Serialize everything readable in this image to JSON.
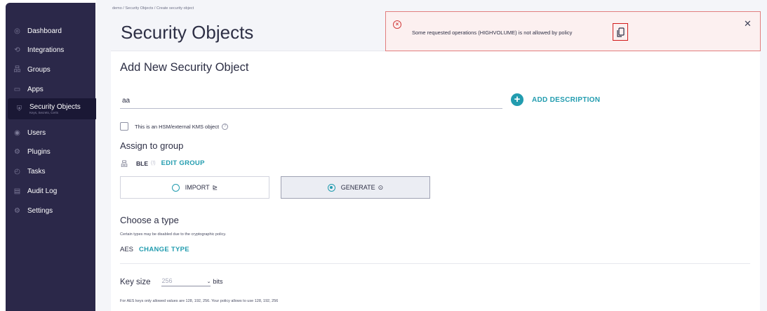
{
  "sidebar": {
    "items": [
      {
        "label": "Dashboard",
        "icon": "dashboard-icon",
        "glyph": "◎"
      },
      {
        "label": "Integrations",
        "icon": "integrations-icon",
        "glyph": "⟲"
      },
      {
        "label": "Groups",
        "icon": "groups-icon",
        "glyph": "品"
      },
      {
        "label": "Apps",
        "icon": "apps-icon",
        "glyph": "▭"
      },
      {
        "label": "Security Objects",
        "sublabel": "Keys, Secrets, Certs",
        "icon": "key-icon",
        "glyph": "⛨",
        "active": true
      },
      {
        "label": "Users",
        "icon": "users-icon",
        "glyph": "◉"
      },
      {
        "label": "Plugins",
        "icon": "plugins-icon",
        "glyph": "⚙"
      },
      {
        "label": "Tasks",
        "icon": "tasks-icon",
        "glyph": "◴"
      },
      {
        "label": "Audit Log",
        "icon": "audit-log-icon",
        "glyph": "▤"
      },
      {
        "label": "Settings",
        "icon": "settings-icon",
        "glyph": "⚙"
      }
    ]
  },
  "breadcrumb": "demo / Security Objects / Create security object",
  "page_title": "Security Objects",
  "form": {
    "title": "Add New Security Object",
    "name_value": "aa",
    "add_description_label": "ADD DESCRIPTION",
    "hsm_label": "This is an HSM/external KMS object",
    "assign_title": "Assign to group",
    "group_name": "BLE",
    "group_info_glyph": "(!)",
    "edit_group_label": "EDIT GROUP",
    "import_label": "IMPORT",
    "import_suffix": "⊵",
    "generate_label": "GENERATE",
    "generate_suffix": "⊙",
    "type_title": "Choose a type",
    "type_note": "Certain types may be disabled due to the cryptographic policy.",
    "type_value": "AES",
    "change_type_label": "CHANGE TYPE",
    "key_size_label": "Key size",
    "key_size_value": "256",
    "key_size_chevron": "⌄",
    "key_size_unit": "bits",
    "key_size_note": "For AES keys only allowed values are 128, 192, 256. Your policy allows to use 128, 192, 256"
  },
  "alert": {
    "message": "Some requested operations (HIGHVOLUME) is not allowed by policy",
    "icon": "error-icon",
    "close_glyph": "✕"
  },
  "colors": {
    "sidebar_bg": "#2b2849",
    "accent": "#229caf",
    "error": "#d23d3d"
  }
}
